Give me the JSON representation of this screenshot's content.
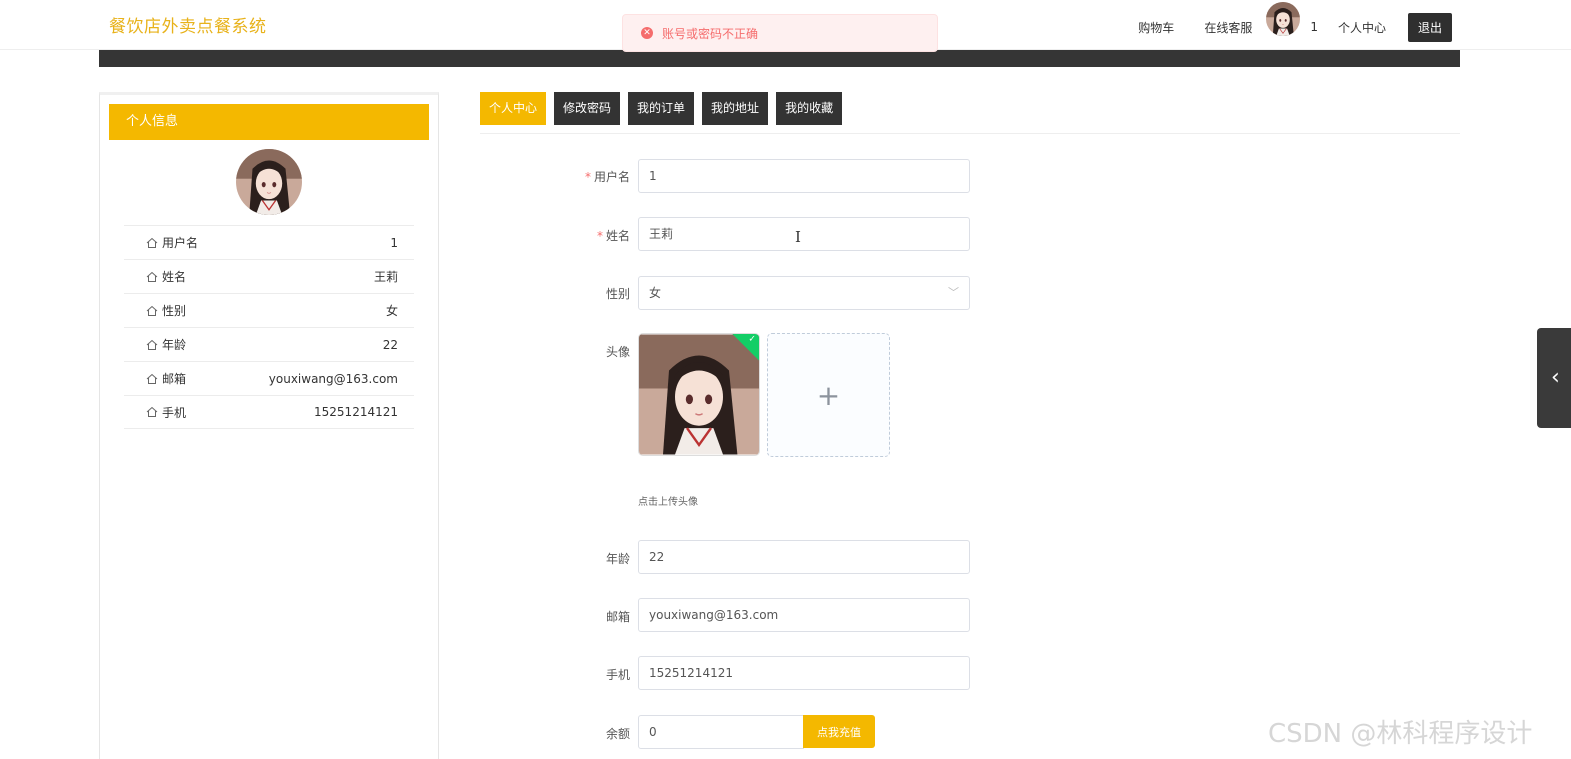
{
  "header": {
    "site_title": "餐饮店外卖点餐系统",
    "nav": {
      "cart": "购物车",
      "support": "在线客服",
      "username": "1",
      "profile": "个人中心",
      "logout": "退出"
    }
  },
  "toast": {
    "icon": "error-circle-icon",
    "message": "账号或密码不正确",
    "color": "#f56c6c"
  },
  "sidebar": {
    "title": "个人信息",
    "rows": [
      {
        "label": "用户名",
        "value": "1"
      },
      {
        "label": "姓名",
        "value": "王莉"
      },
      {
        "label": "性别",
        "value": "女"
      },
      {
        "label": "年龄",
        "value": "22"
      },
      {
        "label": "邮箱",
        "value": "youxiwang@163.com"
      },
      {
        "label": "手机",
        "value": "15251214121"
      }
    ]
  },
  "tabs": [
    {
      "label": "个人中心",
      "active": true
    },
    {
      "label": "修改密码",
      "active": false
    },
    {
      "label": "我的订单",
      "active": false
    },
    {
      "label": "我的地址",
      "active": false
    },
    {
      "label": "我的收藏",
      "active": false
    }
  ],
  "form": {
    "username": {
      "label": "用户名",
      "required": "*",
      "value": "1"
    },
    "name": {
      "label": "姓名",
      "required": "*",
      "value": "王莉"
    },
    "gender": {
      "label": "性别",
      "value": "女"
    },
    "avatar": {
      "label": "头像",
      "upload_tip": "点击上传头像"
    },
    "age": {
      "label": "年龄",
      "value": "22"
    },
    "email": {
      "label": "邮箱",
      "value": "youxiwang@163.com"
    },
    "phone": {
      "label": "手机",
      "value": "15251214121"
    },
    "balance": {
      "label": "余额",
      "value": "0",
      "recharge": "点我充值"
    }
  },
  "watermark": "CSDN @林科程序设计",
  "colors": {
    "accent": "#f4b800",
    "title": "#e8b21a",
    "dark": "#333333",
    "success": "#13ce66"
  }
}
